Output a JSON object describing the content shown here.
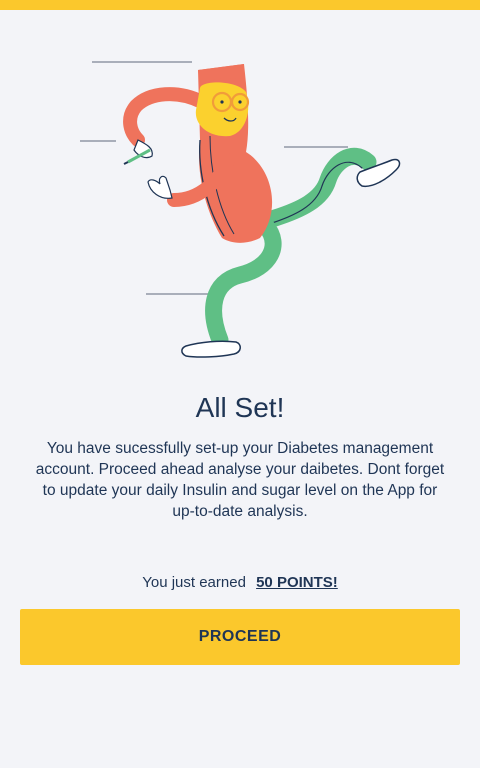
{
  "header": {
    "accent_color": "#fbc82c"
  },
  "illustration": {
    "icon": "running-person-illustration"
  },
  "content": {
    "title": "All Set!",
    "message": "You have sucessfully set-up your Diabetes management account. Proceed ahead analyse your daibetes. Dont forget to update your daily Insulin and sugar level on the App for up-to-date analysis."
  },
  "reward": {
    "prefix": "You just earned",
    "points_label": "50 POINTS!"
  },
  "actions": {
    "proceed_label": "PROCEED"
  }
}
